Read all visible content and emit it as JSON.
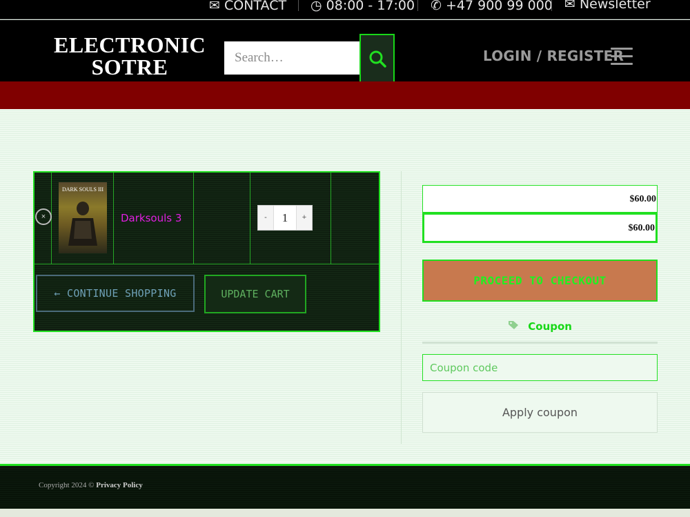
{
  "topbar": {
    "contact": "CONTACT",
    "hours": "08:00 - 17:00",
    "phone": "+47 900 99 000",
    "newsletter": "Newsletter"
  },
  "header": {
    "logo_line1": "ELECTRONIC",
    "logo_line2": "SOTRE",
    "search_placeholder": "Search…",
    "login": "LOGIN / REGISTER"
  },
  "cart": {
    "items": [
      {
        "thumb_text": "DARK SOULS III",
        "name": "Darksouls 3",
        "quantity": "1",
        "minus": "-",
        "plus": "+"
      }
    ],
    "remove_symbol": "×",
    "continue_label": "← CONTINUE SHOPPING",
    "update_label": "UPDATE CART"
  },
  "totals": {
    "subtotal": "$60.00",
    "total": "$60.00",
    "checkout_label": "PROCEED TO CHECKOUT"
  },
  "coupon": {
    "title": "Coupon",
    "placeholder": "Coupon code",
    "apply_label": "Apply coupon"
  },
  "footer": {
    "copyright": "Copyright 2024 ©",
    "privacy": "Privacy Policy"
  },
  "colors": {
    "accent_green": "#21e021",
    "brand_red": "#800000",
    "checkout_bg": "#c8794e",
    "product_link": "#e020e0"
  }
}
